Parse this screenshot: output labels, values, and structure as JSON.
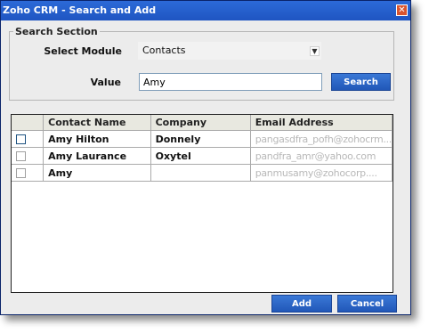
{
  "window": {
    "title": "Zoho CRM - Search and Add",
    "close_glyph": "✕"
  },
  "search_section": {
    "legend": "Search Section",
    "module_label": "Select Module",
    "module_value": "Contacts",
    "value_label": "Value",
    "value_input": "Amy",
    "search_button": "Search"
  },
  "results": {
    "columns": [
      "Contact Name",
      "Company",
      "Email Address"
    ],
    "rows": [
      {
        "name": "Amy Hilton",
        "company": "Donnely",
        "email": "pangasdfra_pofh@zohocrm...",
        "checked": false
      },
      {
        "name": "Amy Laurance",
        "company": "Oxytel",
        "email": "pandfra_amr@yahoo.com",
        "checked": false
      },
      {
        "name": "Amy",
        "company": "",
        "email": "panmusamy@zohocorp....",
        "checked": false
      }
    ]
  },
  "footer": {
    "add_button": "Add",
    "cancel_button": "Cancel"
  },
  "colors": {
    "title_bar": "#2059c6",
    "button": "#2d66cb",
    "dialog_bg": "#ececec"
  }
}
